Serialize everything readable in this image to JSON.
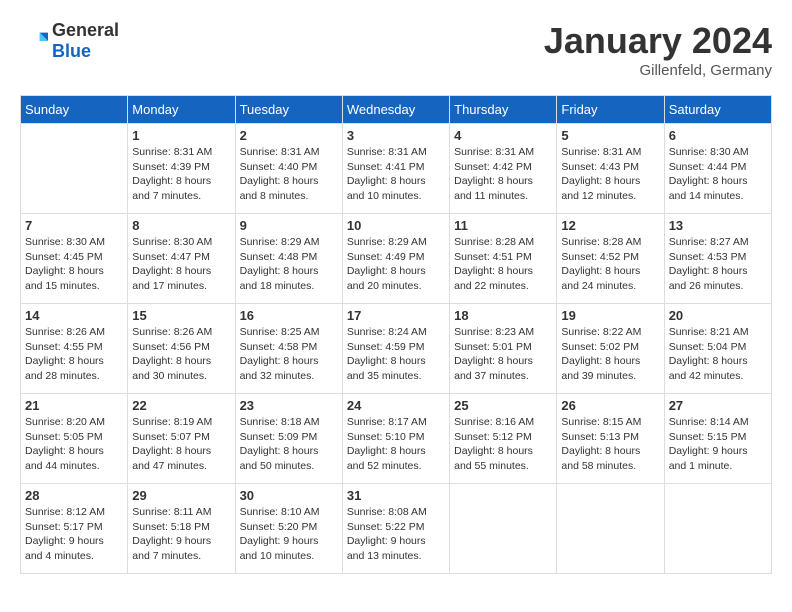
{
  "logo": {
    "general": "General",
    "blue": "Blue"
  },
  "title": "January 2024",
  "location": "Gillenfeld, Germany",
  "days_of_week": [
    "Sunday",
    "Monday",
    "Tuesday",
    "Wednesday",
    "Thursday",
    "Friday",
    "Saturday"
  ],
  "weeks": [
    [
      {
        "day": "",
        "sunrise": "",
        "sunset": "",
        "daylight": ""
      },
      {
        "day": "1",
        "sunrise": "Sunrise: 8:31 AM",
        "sunset": "Sunset: 4:39 PM",
        "daylight": "Daylight: 8 hours and 7 minutes."
      },
      {
        "day": "2",
        "sunrise": "Sunrise: 8:31 AM",
        "sunset": "Sunset: 4:40 PM",
        "daylight": "Daylight: 8 hours and 8 minutes."
      },
      {
        "day": "3",
        "sunrise": "Sunrise: 8:31 AM",
        "sunset": "Sunset: 4:41 PM",
        "daylight": "Daylight: 8 hours and 10 minutes."
      },
      {
        "day": "4",
        "sunrise": "Sunrise: 8:31 AM",
        "sunset": "Sunset: 4:42 PM",
        "daylight": "Daylight: 8 hours and 11 minutes."
      },
      {
        "day": "5",
        "sunrise": "Sunrise: 8:31 AM",
        "sunset": "Sunset: 4:43 PM",
        "daylight": "Daylight: 8 hours and 12 minutes."
      },
      {
        "day": "6",
        "sunrise": "Sunrise: 8:30 AM",
        "sunset": "Sunset: 4:44 PM",
        "daylight": "Daylight: 8 hours and 14 minutes."
      }
    ],
    [
      {
        "day": "7",
        "sunrise": "Sunrise: 8:30 AM",
        "sunset": "Sunset: 4:45 PM",
        "daylight": "Daylight: 8 hours and 15 minutes."
      },
      {
        "day": "8",
        "sunrise": "Sunrise: 8:30 AM",
        "sunset": "Sunset: 4:47 PM",
        "daylight": "Daylight: 8 hours and 17 minutes."
      },
      {
        "day": "9",
        "sunrise": "Sunrise: 8:29 AM",
        "sunset": "Sunset: 4:48 PM",
        "daylight": "Daylight: 8 hours and 18 minutes."
      },
      {
        "day": "10",
        "sunrise": "Sunrise: 8:29 AM",
        "sunset": "Sunset: 4:49 PM",
        "daylight": "Daylight: 8 hours and 20 minutes."
      },
      {
        "day": "11",
        "sunrise": "Sunrise: 8:28 AM",
        "sunset": "Sunset: 4:51 PM",
        "daylight": "Daylight: 8 hours and 22 minutes."
      },
      {
        "day": "12",
        "sunrise": "Sunrise: 8:28 AM",
        "sunset": "Sunset: 4:52 PM",
        "daylight": "Daylight: 8 hours and 24 minutes."
      },
      {
        "day": "13",
        "sunrise": "Sunrise: 8:27 AM",
        "sunset": "Sunset: 4:53 PM",
        "daylight": "Daylight: 8 hours and 26 minutes."
      }
    ],
    [
      {
        "day": "14",
        "sunrise": "Sunrise: 8:26 AM",
        "sunset": "Sunset: 4:55 PM",
        "daylight": "Daylight: 8 hours and 28 minutes."
      },
      {
        "day": "15",
        "sunrise": "Sunrise: 8:26 AM",
        "sunset": "Sunset: 4:56 PM",
        "daylight": "Daylight: 8 hours and 30 minutes."
      },
      {
        "day": "16",
        "sunrise": "Sunrise: 8:25 AM",
        "sunset": "Sunset: 4:58 PM",
        "daylight": "Daylight: 8 hours and 32 minutes."
      },
      {
        "day": "17",
        "sunrise": "Sunrise: 8:24 AM",
        "sunset": "Sunset: 4:59 PM",
        "daylight": "Daylight: 8 hours and 35 minutes."
      },
      {
        "day": "18",
        "sunrise": "Sunrise: 8:23 AM",
        "sunset": "Sunset: 5:01 PM",
        "daylight": "Daylight: 8 hours and 37 minutes."
      },
      {
        "day": "19",
        "sunrise": "Sunrise: 8:22 AM",
        "sunset": "Sunset: 5:02 PM",
        "daylight": "Daylight: 8 hours and 39 minutes."
      },
      {
        "day": "20",
        "sunrise": "Sunrise: 8:21 AM",
        "sunset": "Sunset: 5:04 PM",
        "daylight": "Daylight: 8 hours and 42 minutes."
      }
    ],
    [
      {
        "day": "21",
        "sunrise": "Sunrise: 8:20 AM",
        "sunset": "Sunset: 5:05 PM",
        "daylight": "Daylight: 8 hours and 44 minutes."
      },
      {
        "day": "22",
        "sunrise": "Sunrise: 8:19 AM",
        "sunset": "Sunset: 5:07 PM",
        "daylight": "Daylight: 8 hours and 47 minutes."
      },
      {
        "day": "23",
        "sunrise": "Sunrise: 8:18 AM",
        "sunset": "Sunset: 5:09 PM",
        "daylight": "Daylight: 8 hours and 50 minutes."
      },
      {
        "day": "24",
        "sunrise": "Sunrise: 8:17 AM",
        "sunset": "Sunset: 5:10 PM",
        "daylight": "Daylight: 8 hours and 52 minutes."
      },
      {
        "day": "25",
        "sunrise": "Sunrise: 8:16 AM",
        "sunset": "Sunset: 5:12 PM",
        "daylight": "Daylight: 8 hours and 55 minutes."
      },
      {
        "day": "26",
        "sunrise": "Sunrise: 8:15 AM",
        "sunset": "Sunset: 5:13 PM",
        "daylight": "Daylight: 8 hours and 58 minutes."
      },
      {
        "day": "27",
        "sunrise": "Sunrise: 8:14 AM",
        "sunset": "Sunset: 5:15 PM",
        "daylight": "Daylight: 9 hours and 1 minute."
      }
    ],
    [
      {
        "day": "28",
        "sunrise": "Sunrise: 8:12 AM",
        "sunset": "Sunset: 5:17 PM",
        "daylight": "Daylight: 9 hours and 4 minutes."
      },
      {
        "day": "29",
        "sunrise": "Sunrise: 8:11 AM",
        "sunset": "Sunset: 5:18 PM",
        "daylight": "Daylight: 9 hours and 7 minutes."
      },
      {
        "day": "30",
        "sunrise": "Sunrise: 8:10 AM",
        "sunset": "Sunset: 5:20 PM",
        "daylight": "Daylight: 9 hours and 10 minutes."
      },
      {
        "day": "31",
        "sunrise": "Sunrise: 8:08 AM",
        "sunset": "Sunset: 5:22 PM",
        "daylight": "Daylight: 9 hours and 13 minutes."
      },
      {
        "day": "",
        "sunrise": "",
        "sunset": "",
        "daylight": ""
      },
      {
        "day": "",
        "sunrise": "",
        "sunset": "",
        "daylight": ""
      },
      {
        "day": "",
        "sunrise": "",
        "sunset": "",
        "daylight": ""
      }
    ]
  ]
}
